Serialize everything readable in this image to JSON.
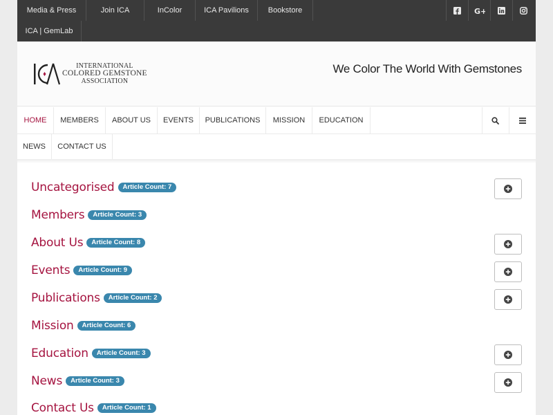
{
  "topbar": {
    "links": [
      "Media & Press",
      "Join ICA",
      "InColor",
      "ICA Pavilions",
      "Bookstore",
      "ICA | GemLab"
    ],
    "social": [
      "facebook-icon",
      "google-plus-icon",
      "linkedin-icon",
      "instagram-icon"
    ]
  },
  "header": {
    "logo_mark": "ICA",
    "logo_line1": "INTERNATIONAL",
    "logo_line2": "COLORED GEMSTONE",
    "logo_line3": "ASSOCIATION",
    "tagline": "We Color The World With Gemstones"
  },
  "nav": {
    "items": [
      "HOME",
      "MEMBERS",
      "ABOUT US",
      "EVENTS",
      "PUBLICATIONS",
      "MISSION",
      "EDUCATION",
      "NEWS",
      "CONTACT US"
    ],
    "active": "HOME",
    "icons": [
      "search-icon",
      "menu-icon"
    ]
  },
  "categories": [
    {
      "title": "Uncategorised",
      "badge": "Article Count:  7",
      "expandable": true
    },
    {
      "title": "Members",
      "badge": "Article Count:  3",
      "expandable": false
    },
    {
      "title": "About Us",
      "badge": "Article Count:  8",
      "expandable": true
    },
    {
      "title": "Events",
      "badge": "Article Count:  9",
      "expandable": true
    },
    {
      "title": "Publications",
      "badge": "Article Count:  2",
      "expandable": true
    },
    {
      "title": "Mission",
      "badge": "Article Count:  6",
      "expandable": false
    },
    {
      "title": "Education",
      "badge": "Article Count:  3",
      "expandable": true
    },
    {
      "title": "News",
      "badge": "Article Count:  3",
      "expandable": true
    },
    {
      "title": "Contact Us",
      "badge": "Article Count:  1",
      "expandable": false
    }
  ],
  "colors": {
    "accent": "#a51440",
    "badge": "#3a87ad",
    "topbar": "#3a3a3a"
  }
}
